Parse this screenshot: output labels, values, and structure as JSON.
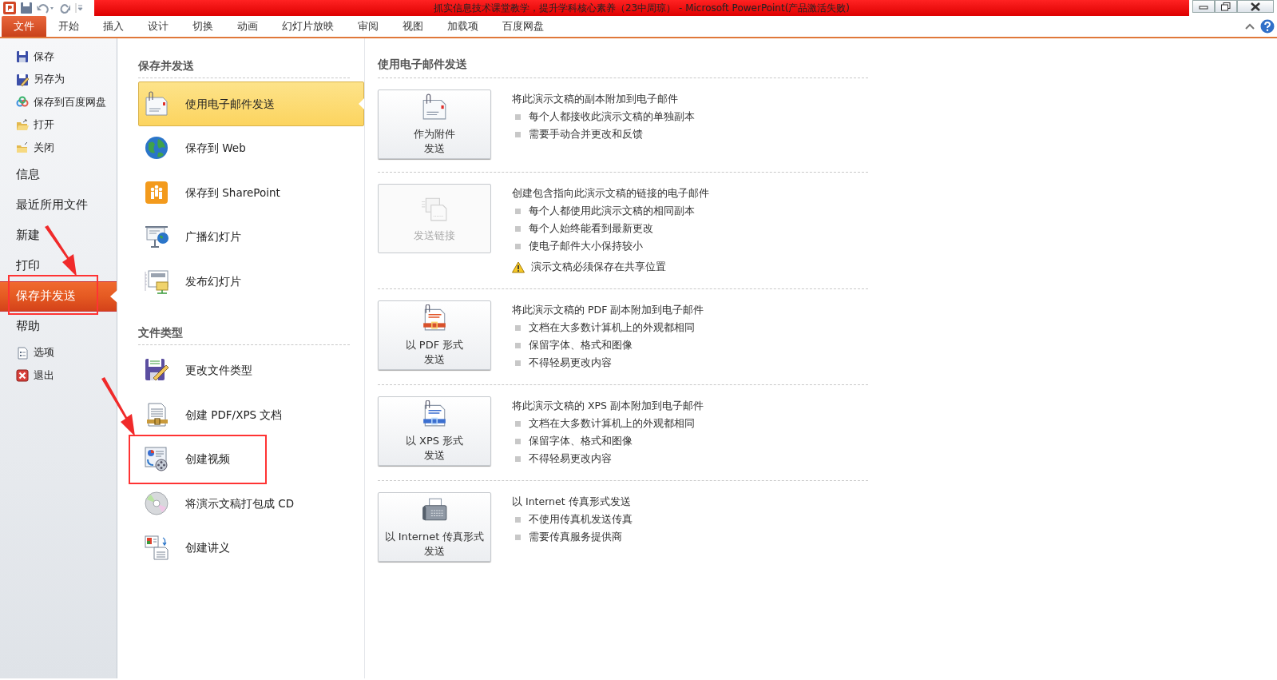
{
  "window": {
    "title": "抓实信息技术课堂教学，提升学科核心素养（23中周琼） - Microsoft PowerPoint(产品激活失败)"
  },
  "ribbon_tabs": [
    {
      "label": "文件",
      "selected": true
    },
    {
      "label": "开始",
      "selected": false
    },
    {
      "label": "插入",
      "selected": false
    },
    {
      "label": "设计",
      "selected": false
    },
    {
      "label": "切换",
      "selected": false
    },
    {
      "label": "动画",
      "selected": false
    },
    {
      "label": "幻灯片放映",
      "selected": false
    },
    {
      "label": "审阅",
      "selected": false
    },
    {
      "label": "视图",
      "selected": false
    },
    {
      "label": "加载项",
      "selected": false
    },
    {
      "label": "百度网盘",
      "selected": false
    }
  ],
  "sidebar": {
    "items": [
      {
        "label": "保存",
        "kind": "save",
        "selected": false,
        "highlighted": false
      },
      {
        "label": "另存为",
        "kind": "saveas",
        "selected": false,
        "highlighted": false
      },
      {
        "label": "保存到百度网盘",
        "kind": "cloud",
        "selected": false,
        "highlighted": false
      },
      {
        "label": "打开",
        "kind": "open",
        "selected": false,
        "highlighted": false
      },
      {
        "label": "关闭",
        "kind": "close",
        "selected": false,
        "highlighted": false
      },
      {
        "label": "信息",
        "kind": "page",
        "selected": false,
        "highlighted": false
      },
      {
        "label": "最近所用文件",
        "kind": "page",
        "selected": false,
        "highlighted": false
      },
      {
        "label": "新建",
        "kind": "page",
        "selected": false,
        "highlighted": false
      },
      {
        "label": "打印",
        "kind": "page",
        "selected": false,
        "highlighted": false
      },
      {
        "label": "保存并发送",
        "kind": "page",
        "selected": true,
        "highlighted": true
      },
      {
        "label": "帮助",
        "kind": "page",
        "selected": false,
        "highlighted": false
      },
      {
        "label": "选项",
        "kind": "options",
        "selected": false,
        "highlighted": false
      },
      {
        "label": "退出",
        "kind": "exit",
        "selected": false,
        "highlighted": false
      }
    ]
  },
  "send_options": {
    "sections": [
      {
        "title": "保存并发送",
        "items": [
          {
            "label": "使用电子邮件发送",
            "kind": "mail",
            "selected": true,
            "highlighted": false
          },
          {
            "label": "保存到 Web",
            "kind": "globe",
            "selected": false,
            "highlighted": false
          },
          {
            "label": "保存到 SharePoint",
            "kind": "sharepoint",
            "selected": false,
            "highlighted": false
          },
          {
            "label": "广播幻灯片",
            "kind": "broadcast",
            "selected": false,
            "highlighted": false
          },
          {
            "label": "发布幻灯片",
            "kind": "publish",
            "selected": false,
            "highlighted": false
          }
        ]
      },
      {
        "title": "文件类型",
        "items": [
          {
            "label": "更改文件类型",
            "kind": "filetype",
            "selected": false,
            "highlighted": false
          },
          {
            "label": "创建 PDF/XPS 文档",
            "kind": "pdfdoc",
            "selected": false,
            "highlighted": false
          },
          {
            "label": "创建视频",
            "kind": "video",
            "selected": false,
            "highlighted": true
          },
          {
            "label": "将演示文稿打包成 CD",
            "kind": "cd",
            "selected": false,
            "highlighted": false
          },
          {
            "label": "创建讲义",
            "kind": "handout",
            "selected": false,
            "highlighted": false
          }
        ]
      }
    ]
  },
  "detail": {
    "title": "使用电子邮件发送",
    "options": [
      {
        "button": [
          "作为附件",
          "发送"
        ],
        "kind": "attach",
        "disabled": false,
        "description": "将此演示文稿的副本附加到电子邮件",
        "bullets": [
          "每个人都接收此演示文稿的单独副本",
          "需要手动合并更改和反馈"
        ]
      },
      {
        "button": [
          "发送链接"
        ],
        "kind": "link",
        "disabled": true,
        "description": "创建包含指向此演示文稿的链接的电子邮件",
        "bullets": [
          "每个人都使用此演示文稿的相同副本",
          "每个人始终能看到最新更改",
          "使电子邮件大小保持较小"
        ],
        "warning": "演示文稿必须保存在共享位置"
      },
      {
        "button": [
          "以 PDF 形式",
          "发送"
        ],
        "kind": "pdf",
        "disabled": false,
        "description": "将此演示文稿的 PDF 副本附加到电子邮件",
        "bullets": [
          "文档在大多数计算机上的外观都相同",
          "保留字体、格式和图像",
          "不得轻易更改内容"
        ]
      },
      {
        "button": [
          "以 XPS 形式",
          "发送"
        ],
        "kind": "xps",
        "disabled": false,
        "description": "将此演示文稿的 XPS 副本附加到电子邮件",
        "bullets": [
          "文档在大多数计算机上的外观都相同",
          "保留字体、格式和图像",
          "不得轻易更改内容"
        ]
      },
      {
        "button": [
          "以 Internet 传真形式",
          "发送"
        ],
        "kind": "fax",
        "disabled": false,
        "description": "以 Internet 传真形式发送",
        "bullets": [
          "不使用传真机发送传真",
          "需要传真服务提供商"
        ]
      }
    ]
  }
}
